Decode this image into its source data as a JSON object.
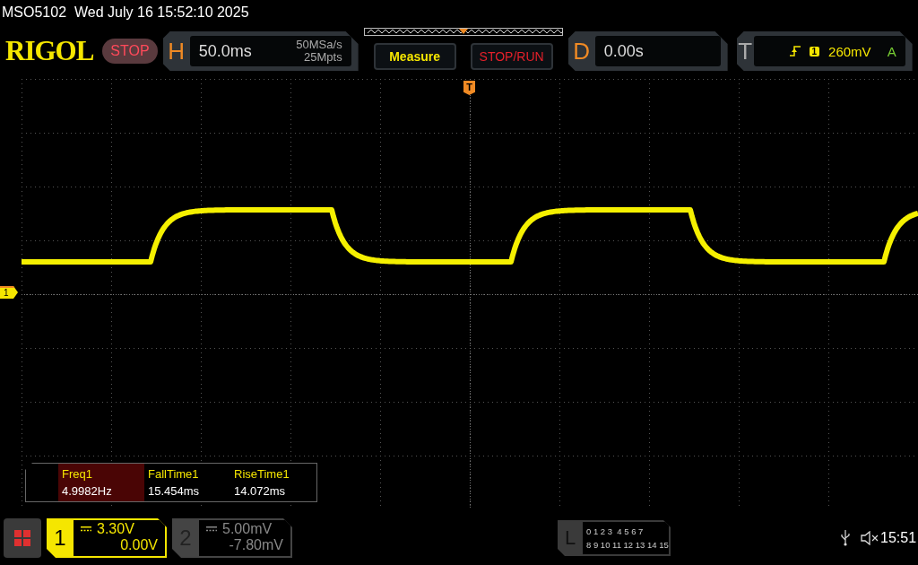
{
  "title_bar": {
    "model": "MSO5102",
    "datetime": "Wed July 16 15:52:10 2025"
  },
  "logo": "RIGOL",
  "run_state": "STOP",
  "horizontal": {
    "label": "H",
    "timebase": "50.0ms",
    "sample_rate": "50MSa/s",
    "memory_depth": "25Mpts"
  },
  "buttons": [
    {
      "label": "Measure",
      "kind": "measure"
    },
    {
      "label": "STOP/RUN",
      "kind": "run"
    }
  ],
  "delay": {
    "label": "D",
    "value": "0.00s"
  },
  "trigger": {
    "label": "T",
    "source": "1",
    "level": "260mV",
    "mode": "A"
  },
  "trigger_marker": "T",
  "channel_marker": "1",
  "measurements": [
    {
      "name": "Freq1",
      "value": "4.9982Hz",
      "selected": true
    },
    {
      "name": "FallTime1",
      "value": "15.454ms",
      "selected": false
    },
    {
      "name": "RiseTime1",
      "value": "14.072ms",
      "selected": false
    }
  ],
  "channels": [
    {
      "number": "1",
      "scale": "3.30V",
      "offset": "0.00V",
      "on": true
    },
    {
      "number": "2",
      "scale": "5.00mV",
      "offset": "-7.80mV",
      "on": false
    }
  ],
  "logic": {
    "label": "L",
    "rows": [
      "0 1 2 3  4 5 6 7",
      "8 9 10 11 12 13 14 15"
    ]
  },
  "clock": "15:51"
}
